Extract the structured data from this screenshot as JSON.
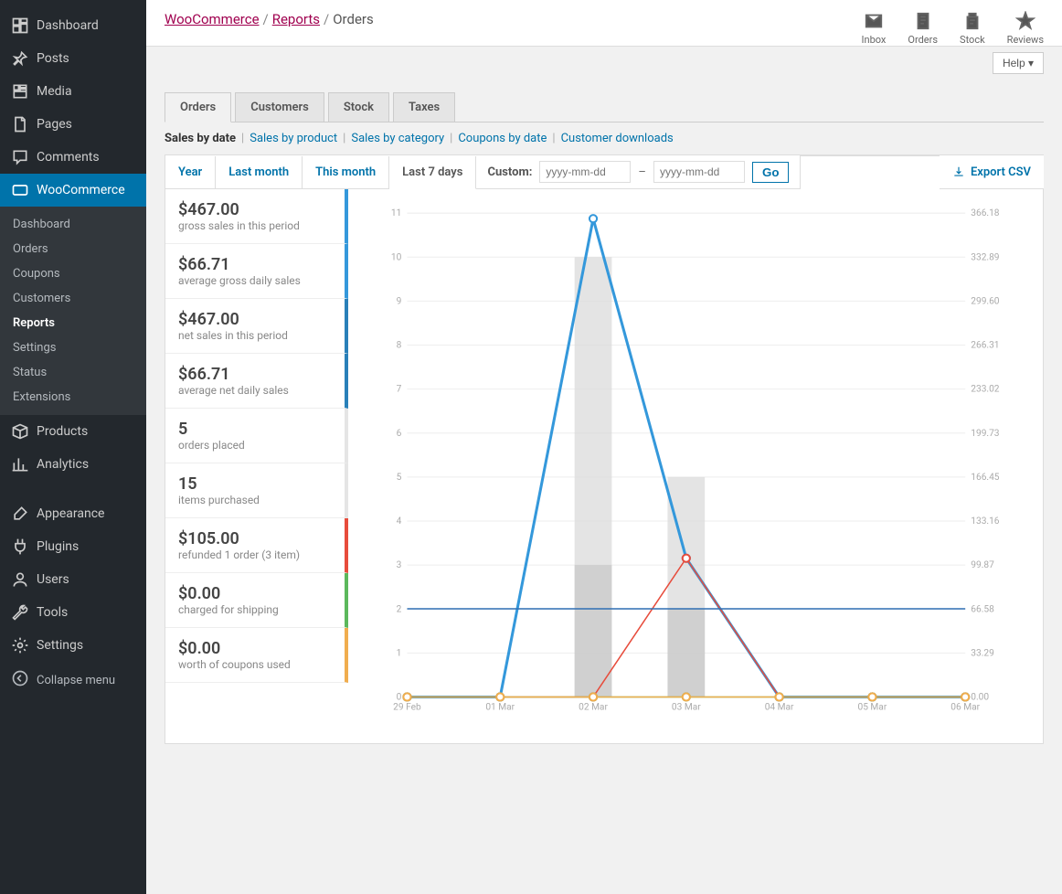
{
  "sidebar": {
    "items": [
      {
        "label": "Dashboard",
        "icon": "dashboard"
      },
      {
        "label": "Posts",
        "icon": "pin"
      },
      {
        "label": "Media",
        "icon": "media"
      },
      {
        "label": "Pages",
        "icon": "page"
      },
      {
        "label": "Comments",
        "icon": "comment"
      },
      {
        "label": "WooCommerce",
        "icon": "woo",
        "active": true,
        "submenu": [
          {
            "label": "Dashboard"
          },
          {
            "label": "Orders"
          },
          {
            "label": "Coupons"
          },
          {
            "label": "Customers"
          },
          {
            "label": "Reports",
            "active": true
          },
          {
            "label": "Settings"
          },
          {
            "label": "Status"
          },
          {
            "label": "Extensions"
          }
        ]
      },
      {
        "label": "Products",
        "icon": "box"
      },
      {
        "label": "Analytics",
        "icon": "analytics"
      },
      {
        "label": "Appearance",
        "icon": "brush"
      },
      {
        "label": "Plugins",
        "icon": "plug"
      },
      {
        "label": "Users",
        "icon": "user"
      },
      {
        "label": "Tools",
        "icon": "wrench"
      },
      {
        "label": "Settings",
        "icon": "settings"
      }
    ],
    "collapse_label": "Collapse menu"
  },
  "breadcrumb": {
    "items": [
      "WooCommerce",
      "Reports",
      "Orders"
    ]
  },
  "top_icons": [
    {
      "label": "Inbox",
      "icon": "inbox"
    },
    {
      "label": "Orders",
      "icon": "orders"
    },
    {
      "label": "Stock",
      "icon": "stock"
    },
    {
      "label": "Reviews",
      "icon": "star"
    }
  ],
  "help_label": "Help ▾",
  "tabs": [
    {
      "label": "Orders",
      "active": true
    },
    {
      "label": "Customers"
    },
    {
      "label": "Stock"
    },
    {
      "label": "Taxes"
    }
  ],
  "subtabs": [
    {
      "label": "Sales by date",
      "active": true
    },
    {
      "label": "Sales by product"
    },
    {
      "label": "Sales by category"
    },
    {
      "label": "Coupons by date"
    },
    {
      "label": "Customer downloads"
    }
  ],
  "ranges": [
    {
      "label": "Year"
    },
    {
      "label": "Last month"
    },
    {
      "label": "This month"
    },
    {
      "label": "Last 7 days",
      "active": true
    }
  ],
  "custom": {
    "label": "Custom:",
    "from_ph": "yyyy-mm-dd",
    "to_ph": "yyyy-mm-dd",
    "go": "Go"
  },
  "export_label": "Export CSV",
  "stats": [
    {
      "value": "$467.00",
      "label": "gross sales in this period",
      "color": "blue"
    },
    {
      "value": "$66.71",
      "label": "average gross daily sales",
      "color": "blue"
    },
    {
      "value": "$467.00",
      "label": "net sales in this period",
      "color": "dblue"
    },
    {
      "value": "$66.71",
      "label": "average net daily sales",
      "color": "dblue"
    },
    {
      "value": "5",
      "label": "orders placed",
      "color": "grey"
    },
    {
      "value": "15",
      "label": "items purchased",
      "color": "grey"
    },
    {
      "value": "$105.00",
      "label": "refunded 1 order (3 item)",
      "color": "red"
    },
    {
      "value": "$0.00",
      "label": "charged for shipping",
      "color": "green"
    },
    {
      "value": "$0.00",
      "label": "worth of coupons used",
      "color": "orange"
    }
  ],
  "chart_data": {
    "type": "line",
    "categories": [
      "29 Feb",
      "01 Mar",
      "02 Mar",
      "03 Mar",
      "04 Mar",
      "05 Mar",
      "06 Mar"
    ],
    "left_axis": {
      "ticks": [
        0,
        1,
        2,
        3,
        4,
        5,
        6,
        7,
        8,
        9,
        10,
        11
      ]
    },
    "right_axis": {
      "ticks": [
        0.0,
        33.29,
        66.58,
        99.87,
        133.16,
        166.45,
        199.73,
        233.02,
        266.31,
        299.6,
        332.89,
        366.18
      ]
    },
    "bars": {
      "name": "items purchased",
      "axis": "left",
      "values": [
        0,
        0,
        10,
        5,
        0,
        0,
        0
      ]
    },
    "bars2": {
      "name": "orders placed",
      "axis": "left",
      "values": [
        0,
        0,
        3,
        2,
        0,
        0,
        0
      ]
    },
    "series": [
      {
        "name": "gross sales",
        "axis": "right",
        "color": "#3498db",
        "values": [
          0,
          0,
          362,
          105,
          0,
          0,
          0
        ],
        "thick": true
      },
      {
        "name": "refunds",
        "axis": "right",
        "color": "#e74c3c",
        "values": [
          0,
          0,
          0,
          105,
          0,
          0,
          0
        ]
      },
      {
        "name": "shipping",
        "axis": "right",
        "color": "#5cb85c",
        "values": [
          0,
          0,
          0,
          0,
          0,
          0,
          0
        ]
      },
      {
        "name": "coupons",
        "axis": "right",
        "color": "#f0ad4e",
        "values": [
          0,
          0,
          0,
          0,
          0,
          0,
          0
        ]
      },
      {
        "name": "average",
        "axis": "right",
        "color": "#2f6fb3",
        "values": [
          66.71,
          66.71,
          66.71,
          66.71,
          66.71,
          66.71,
          66.71
        ],
        "flat": true
      }
    ]
  }
}
